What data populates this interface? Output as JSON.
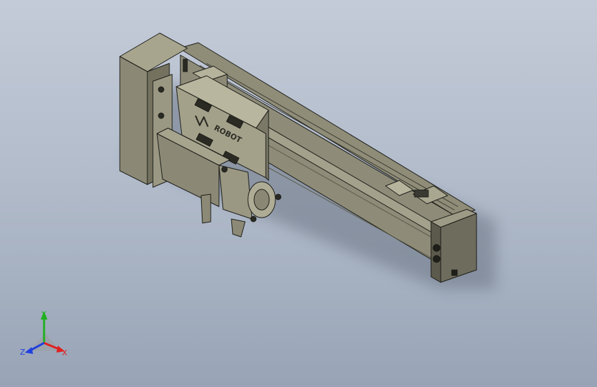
{
  "model": {
    "engraving": "ROBOT"
  },
  "triad": {
    "x_label": "X",
    "y_label": "Y",
    "z_label": "Z",
    "colors": {
      "x": "#e02020",
      "y": "#20b020",
      "z": "#2040e0"
    }
  }
}
